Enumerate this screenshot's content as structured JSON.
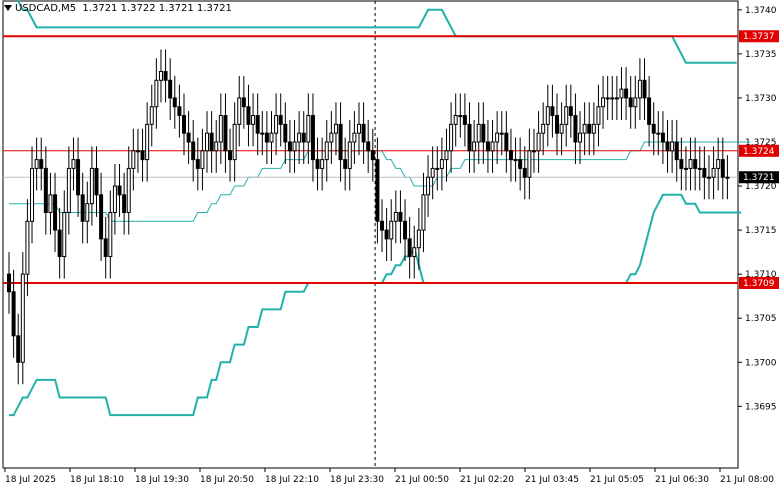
{
  "header": {
    "symbol": "USDCAD,M5",
    "ohlc": "1.3721 1.3722 1.3721 1.3721"
  },
  "colors": {
    "background": "#ffffff",
    "candle": "#000000",
    "band": "#20b2aa",
    "level_line": "#e00000",
    "level_label_bg": "#e00000",
    "current_label_bg": "#000000",
    "grid_axis": "#000000"
  },
  "chart_data": {
    "type": "candlestick",
    "symbol": "USDCAD",
    "timeframe": "M5",
    "ylim": [
      1.3688,
      1.3741
    ],
    "y_ticks": [
      "1.3740",
      "1.3735",
      "1.3730",
      "1.3725",
      "1.3720",
      "1.3715",
      "1.3710",
      "1.3705",
      "1.3700",
      "1.3695"
    ],
    "x_ticks": [
      "18 Jul 2025",
      "18 Jul 18:10",
      "18 Jul 19:30",
      "18 Jul 20:50",
      "18 Jul 22:10",
      "18 Jul 23:30",
      "21 Jul 00:50",
      "21 Jul 02:20",
      "21 Jul 03:45",
      "21 Jul 05:05",
      "21 Jul 06:30",
      "21 Jul 08:00"
    ],
    "levels": [
      {
        "label": "1.3737",
        "value": 1.3737,
        "style": "thick"
      },
      {
        "label": "1.3724",
        "value": 1.3724,
        "style": "thin"
      },
      {
        "label": "1.3709",
        "value": 1.3709,
        "style": "thick"
      }
    ],
    "current_price": {
      "label": "1.3721",
      "value": 1.3721
    },
    "session_break_index": 80,
    "closes": [
      1.3708,
      1.3703,
      1.37,
      1.371,
      1.3716,
      1.3722,
      1.3723,
      1.3722,
      1.3717,
      1.3719,
      1.3715,
      1.3712,
      1.3717,
      1.3722,
      1.3723,
      1.3719,
      1.3716,
      1.3718,
      1.3722,
      1.3719,
      1.3714,
      1.3712,
      1.3717,
      1.372,
      1.3719,
      1.3717,
      1.3722,
      1.3724,
      1.3724,
      1.3723,
      1.3727,
      1.3729,
      1.3732,
      1.3733,
      1.3732,
      1.373,
      1.3729,
      1.3728,
      1.3726,
      1.3725,
      1.3723,
      1.3722,
      1.3724,
      1.3726,
      1.3724,
      1.3725,
      1.3728,
      1.3724,
      1.3723,
      1.3727,
      1.373,
      1.3729,
      1.3727,
      1.3728,
      1.3726,
      1.3726,
      1.3725,
      1.3726,
      1.3728,
      1.3727,
      1.3725,
      1.3724,
      1.3725,
      1.3726,
      1.3725,
      1.3728,
      1.3723,
      1.3722,
      1.3723,
      1.3725,
      1.3726,
      1.3727,
      1.3723,
      1.3722,
      1.3725,
      1.3726,
      1.3727,
      1.3725,
      1.3724,
      1.3723,
      1.3716,
      1.3715,
      1.3714,
      1.3716,
      1.3717,
      1.3716,
      1.3714,
      1.3712,
      1.3713,
      1.3715,
      1.3719,
      1.3721,
      1.3722,
      1.3722,
      1.3723,
      1.3724,
      1.3727,
      1.3728,
      1.3728,
      1.3727,
      1.3724,
      1.3725,
      1.3727,
      1.3725,
      1.3724,
      1.3725,
      1.3726,
      1.3726,
      1.3724,
      1.3723,
      1.3723,
      1.3722,
      1.3721,
      1.3724,
      1.3724,
      1.3726,
      1.3727,
      1.3729,
      1.3728,
      1.3726,
      1.3727,
      1.3729,
      1.3728,
      1.3725,
      1.3726,
      1.3727,
      1.3726,
      1.3727,
      1.3729,
      1.373,
      1.373,
      1.373,
      1.373,
      1.3731,
      1.373,
      1.3729,
      1.373,
      1.3732,
      1.373,
      1.3727,
      1.3726,
      1.3726,
      1.3725,
      1.3724,
      1.3725,
      1.3723,
      1.3722,
      1.3722,
      1.3723,
      1.3722,
      1.3722,
      1.3721,
      1.3721,
      1.3722,
      1.3723,
      1.3721,
      1.3721
    ],
    "upper_band": [
      1.3742,
      1.3742,
      1.3741,
      1.374,
      1.374,
      1.3739,
      1.3738,
      1.3738,
      1.3738,
      1.3738,
      1.3738,
      1.3738,
      1.3738,
      1.3738,
      1.3738,
      1.3738,
      1.3738,
      1.3738,
      1.3738,
      1.3738,
      1.3738,
      1.3738,
      1.3738,
      1.3738,
      1.3738,
      1.3738,
      1.3738,
      1.3738,
      1.3738,
      1.3738,
      1.3738,
      1.3738,
      1.3738,
      1.3738,
      1.3738,
      1.3738,
      1.3738,
      1.3738,
      1.3738,
      1.3738,
      1.3738,
      1.3738,
      1.3738,
      1.3738,
      1.3738,
      1.3738,
      1.3738,
      1.3738,
      1.3738,
      1.3738,
      1.3738,
      1.3738,
      1.3738,
      1.3738,
      1.3738,
      1.3738,
      1.3738,
      1.3738,
      1.3738,
      1.3738,
      1.3738,
      1.3738,
      1.3738,
      1.3738,
      1.3738,
      1.3738,
      1.3738,
      1.3738,
      1.3738,
      1.3738,
      1.3738,
      1.3738,
      1.3738,
      1.3738,
      1.3738,
      1.3738,
      1.3738,
      1.3738,
      1.3738,
      1.3738,
      1.3738,
      1.3738,
      1.3738,
      1.3738,
      1.3738,
      1.3738,
      1.3738,
      1.3738,
      1.3738,
      1.3738,
      1.3739,
      1.374,
      1.374,
      1.374,
      1.374,
      1.3739,
      1.3738,
      1.3737,
      1.3737,
      1.3737,
      1.3737,
      1.3737,
      1.3737,
      1.3737,
      1.3737,
      1.3737,
      1.3737,
      1.3737,
      1.3737,
      1.3737,
      1.3737,
      1.3737,
      1.3737,
      1.3737,
      1.3737,
      1.3737,
      1.3737,
      1.3737,
      1.3737,
      1.3737,
      1.3737,
      1.3737,
      1.3737,
      1.3737,
      1.3737,
      1.3737,
      1.3737,
      1.3737,
      1.3737,
      1.3737,
      1.3737,
      1.3737,
      1.3737,
      1.3737,
      1.3737,
      1.3737,
      1.3737,
      1.3737,
      1.3737,
      1.3737,
      1.3737,
      1.3737,
      1.3737,
      1.3737,
      1.3737,
      1.3736,
      1.3735,
      1.3734,
      1.3734,
      1.3734,
      1.3734,
      1.3734,
      1.3734,
      1.3734,
      1.3734,
      1.3734,
      1.3734,
      1.3734,
      1.3734
    ],
    "middle_band": [
      1.3718,
      1.3718,
      1.3718,
      1.3718,
      1.3718,
      1.3718,
      1.3718,
      1.3718,
      1.3718,
      1.3718,
      1.3718,
      1.3717,
      1.3717,
      1.3717,
      1.3717,
      1.3717,
      1.3717,
      1.3717,
      1.3717,
      1.3717,
      1.3717,
      1.3717,
      1.3716,
      1.3716,
      1.3716,
      1.3716,
      1.3716,
      1.3716,
      1.3716,
      1.3716,
      1.3716,
      1.3716,
      1.3716,
      1.3716,
      1.3716,
      1.3716,
      1.3716,
      1.3716,
      1.3716,
      1.3716,
      1.3716,
      1.3717,
      1.3717,
      1.3717,
      1.3718,
      1.3718,
      1.3719,
      1.3719,
      1.3719,
      1.372,
      1.372,
      1.372,
      1.3721,
      1.3721,
      1.3721,
      1.3722,
      1.3722,
      1.3722,
      1.3722,
      1.3722,
      1.3723,
      1.3723,
      1.3723,
      1.3723,
      1.3723,
      1.3724,
      1.3724,
      1.3724,
      1.3724,
      1.3724,
      1.3724,
      1.3724,
      1.3724,
      1.3724,
      1.3724,
      1.3724,
      1.3724,
      1.3724,
      1.3724,
      1.3724,
      1.3724,
      1.3724,
      1.3723,
      1.3723,
      1.3722,
      1.3722,
      1.3721,
      1.3721,
      1.372,
      1.372,
      1.372,
      1.372,
      1.372,
      1.3721,
      1.3721,
      1.3721,
      1.3722,
      1.3722,
      1.3722,
      1.3723,
      1.3723,
      1.3723,
      1.3723,
      1.3723,
      1.3723,
      1.3723,
      1.3723,
      1.3723,
      1.3723,
      1.3723,
      1.3723,
      1.3723,
      1.3723,
      1.3723,
      1.3723,
      1.3723,
      1.3723,
      1.3723,
      1.3723,
      1.3723,
      1.3723,
      1.3723,
      1.3723,
      1.3723,
      1.3723,
      1.3723,
      1.3723,
      1.3723,
      1.3723,
      1.3723,
      1.3723,
      1.3723,
      1.3723,
      1.3723,
      1.3723,
      1.3724,
      1.3724,
      1.3724,
      1.3725,
      1.3725,
      1.3725,
      1.3725,
      1.3725,
      1.3725,
      1.3725,
      1.3725,
      1.3725,
      1.3725,
      1.3725,
      1.3725,
      1.3725,
      1.3725,
      1.3725,
      1.3725,
      1.3725,
      1.3725,
      1.3725,
      1.3725,
      1.3725,
      1.3725,
      1.3725,
      1.3725
    ],
    "lower_band": [
      1.3694,
      1.3694,
      1.3695,
      1.3696,
      1.3696,
      1.3697,
      1.3698,
      1.3698,
      1.3698,
      1.3698,
      1.3698,
      1.3696,
      1.3696,
      1.3696,
      1.3696,
      1.3696,
      1.3696,
      1.3696,
      1.3696,
      1.3696,
      1.3696,
      1.3696,
      1.3694,
      1.3694,
      1.3694,
      1.3694,
      1.3694,
      1.3694,
      1.3694,
      1.3694,
      1.3694,
      1.3694,
      1.3694,
      1.3694,
      1.3694,
      1.3694,
      1.3694,
      1.3694,
      1.3694,
      1.3694,
      1.3694,
      1.3696,
      1.3696,
      1.3696,
      1.3698,
      1.3698,
      1.37,
      1.37,
      1.37,
      1.3702,
      1.3702,
      1.3702,
      1.3704,
      1.3704,
      1.3704,
      1.3706,
      1.3706,
      1.3706,
      1.3706,
      1.3706,
      1.3708,
      1.3708,
      1.3708,
      1.3708,
      1.3708,
      1.3709,
      1.3709,
      1.3709,
      1.3709,
      1.3709,
      1.3709,
      1.3709,
      1.3709,
      1.3709,
      1.3709,
      1.3709,
      1.3709,
      1.3709,
      1.3709,
      1.3709,
      1.3709,
      1.3709,
      1.371,
      1.371,
      1.3711,
      1.3711,
      1.3712,
      1.3712,
      1.3713,
      1.3711,
      1.3709,
      1.3709,
      1.3709,
      1.3709,
      1.3709,
      1.3709,
      1.3709,
      1.3709,
      1.3709,
      1.3709,
      1.3709,
      1.3709,
      1.3709,
      1.3709,
      1.3709,
      1.3709,
      1.3709,
      1.3709,
      1.3709,
      1.3709,
      1.3709,
      1.3709,
      1.3709,
      1.3709,
      1.3709,
      1.3709,
      1.3709,
      1.3709,
      1.3709,
      1.3709,
      1.3709,
      1.3709,
      1.3709,
      1.3709,
      1.3709,
      1.3709,
      1.3709,
      1.3709,
      1.3709,
      1.3709,
      1.3709,
      1.3709,
      1.3709,
      1.3709,
      1.3709,
      1.371,
      1.371,
      1.3711,
      1.3713,
      1.3715,
      1.3717,
      1.3718,
      1.3719,
      1.3719,
      1.3719,
      1.3719,
      1.3719,
      1.3718,
      1.3718,
      1.3718,
      1.3717,
      1.3717,
      1.3717,
      1.3717,
      1.3717,
      1.3717,
      1.3717,
      1.3717,
      1.3717,
      1.3717
    ]
  }
}
